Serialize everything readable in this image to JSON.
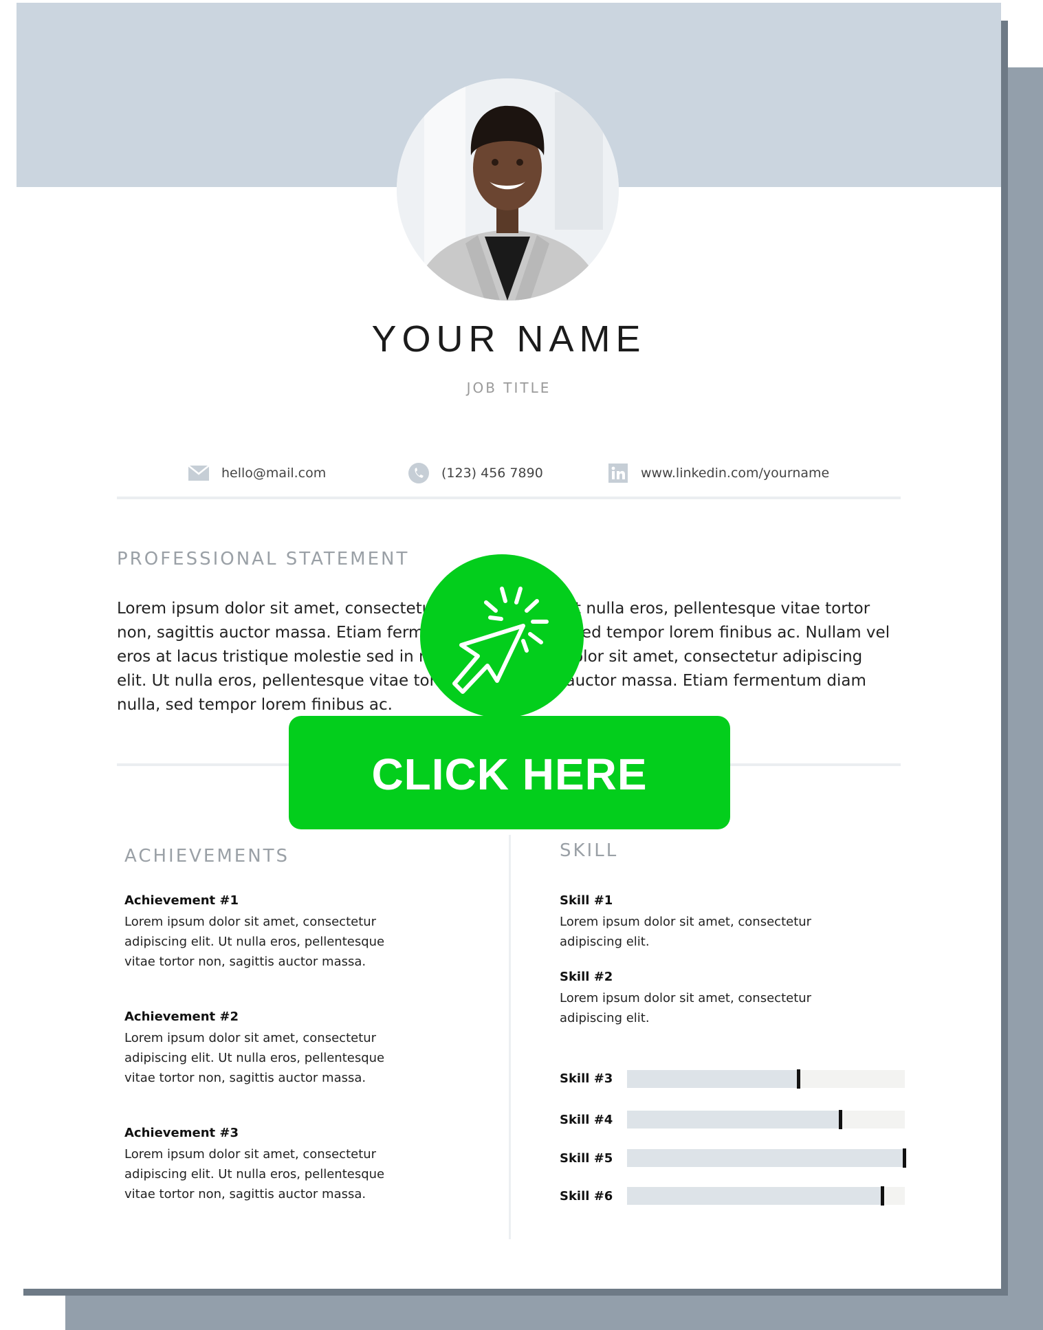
{
  "profile": {
    "name": "YOUR NAME",
    "job_title": "JOB TITLE"
  },
  "contact": {
    "email": "hello@mail.com",
    "phone": "(123) 456 7890",
    "linkedin": "www.linkedin.com/yourname"
  },
  "statement": {
    "title": "PROFESSIONAL STATEMENT",
    "lines": [
      "Lorem ipsum dolor sit amet, consectetur adipiscing elit. Ut nulla eros, pellentesque vitae tortor",
      "non, sagittis auctor massa. Etiam fermentum diam nulla, sed tempor lorem finibus ac. Nullam vel",
      "eros at lacus tristique molestie sed in nisl. Lorem ipsum dolor sit amet, consectetur adipiscing",
      "elit. Ut nulla eros, pellentesque vitae tortor non, sagittis auctor massa. Etiam fermentum diam",
      "nulla, sed tempor lorem finibus ac."
    ]
  },
  "achievements": {
    "title": "ACHIEVEMENTS",
    "items": [
      {
        "title": "Achievement #1",
        "lines": [
          "Lorem ipsum dolor sit amet, consectetur",
          "adipiscing elit. Ut nulla eros, pellentesque",
          "vitae tortor non, sagittis auctor massa."
        ]
      },
      {
        "title": "Achievement #2",
        "lines": [
          "Lorem ipsum dolor sit amet, consectetur",
          "adipiscing elit. Ut nulla eros, pellentesque",
          "vitae tortor non, sagittis auctor massa."
        ]
      },
      {
        "title": "Achievement #3",
        "lines": [
          "Lorem ipsum dolor sit amet, consectetur",
          "adipiscing elit. Ut nulla eros, pellentesque",
          "vitae tortor non, sagittis auctor massa."
        ]
      }
    ]
  },
  "skills": {
    "title": "SKILL",
    "items": [
      {
        "title": "Skill #1",
        "lines": [
          "Lorem ipsum dolor sit amet, consectetur",
          "adipiscing elit."
        ]
      },
      {
        "title": "Skill #2",
        "lines": [
          "Lorem ipsum dolor sit amet, consectetur",
          "adipiscing elit."
        ]
      }
    ],
    "bars": [
      {
        "label": "Skill #3",
        "level": 0.62
      },
      {
        "label": "Skill #4",
        "level": 0.77
      },
      {
        "label": "Skill #5",
        "level": 1.0
      },
      {
        "label": "Skill #6",
        "level": 0.92
      }
    ]
  },
  "cta": {
    "label": "CLICK HERE"
  },
  "colors": {
    "header_band": "#cbd5df",
    "cta_green": "#03ce1c",
    "backdrop": "#939fab",
    "skill_fill": "#dde3e8"
  },
  "icons": {
    "email": "envelope-icon",
    "phone": "phone-icon",
    "linkedin": "linkedin-icon",
    "cta": "cursor-click-icon"
  }
}
